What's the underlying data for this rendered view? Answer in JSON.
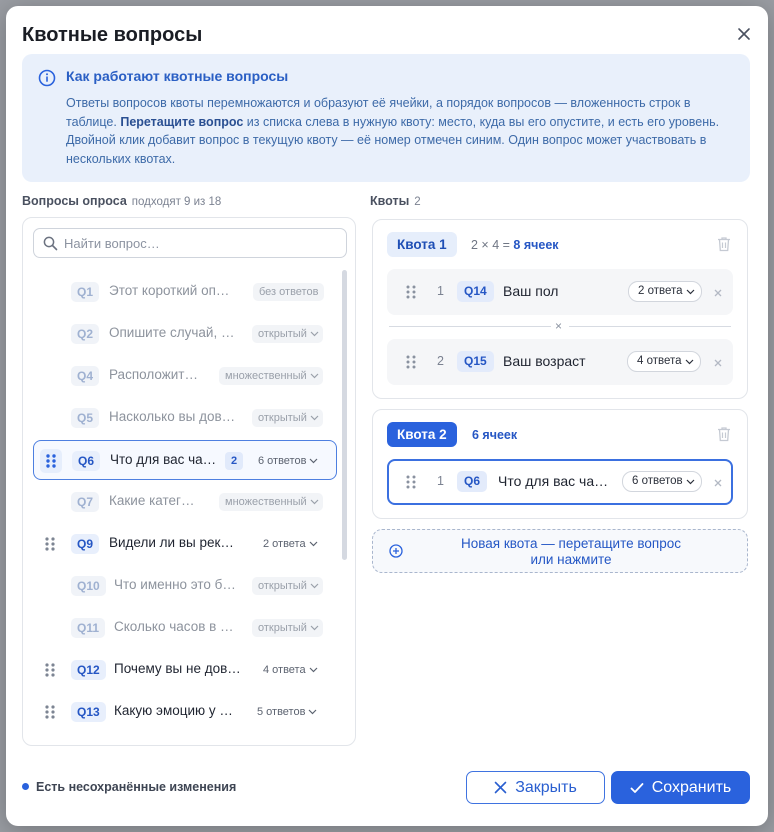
{
  "title": "Квотные вопросы",
  "info": {
    "title": "Как работают квотные вопросы",
    "text_1": "Ответы вопросов квоты перемножаются и образуют её ячейки, а порядок вопросов — вложенность строк в таблице. ",
    "text_bold": "Перетащите вопрос",
    "text_2": " из списка слева в нужную квоту: место, куда вы его опустите, и есть его уровень. Двойной клик добавит вопрос в текущую квоту — её номер отмечен синим. Один вопрос может участвовать в нескольких квотах."
  },
  "left": {
    "label": "Вопросы опроса",
    "sub": "подходят 9 из 18",
    "search_placeholder": "Найти вопрос…",
    "questions": [
      {
        "code": "Q1",
        "text": "Этот короткий оп…",
        "badge": "без ответов",
        "disabled": true
      },
      {
        "code": "Q2",
        "text": "Опишите случай, …",
        "badge": "открытый",
        "disabled": true
      },
      {
        "code": "Q4",
        "text": "Расположит…",
        "badge": "множественный",
        "disabled": true
      },
      {
        "code": "Q5",
        "text": "Насколько вы дов…",
        "badge": "открытый",
        "disabled": true
      },
      {
        "code": "Q6",
        "text": "Что для вас ча…",
        "count": "2",
        "badge": "6 ответов",
        "selected": true
      },
      {
        "code": "Q7",
        "text": "Какие катег…",
        "badge": "множественный",
        "disabled": true
      },
      {
        "code": "Q9",
        "text": "Видели ли вы рек…",
        "badge": "2 ответа"
      },
      {
        "code": "Q10",
        "text": "Что именно это б…",
        "badge": "открытый",
        "disabled": true
      },
      {
        "code": "Q11",
        "text": "Сколько часов в …",
        "badge": "открытый",
        "disabled": true
      },
      {
        "code": "Q12",
        "text": "Почему вы не дов…",
        "badge": "4 ответа"
      },
      {
        "code": "Q13",
        "text": "Какую эмоцию у …",
        "badge": "5 ответов"
      }
    ]
  },
  "right": {
    "label": "Квоты",
    "count": "2",
    "quota1": {
      "tag": "Квота 1",
      "formula": "2 × 4 = ",
      "cells": "8 ячеек",
      "rows": [
        {
          "num": "1",
          "code": "Q14",
          "text": "Ваш пол",
          "select": "2 ответа"
        },
        {
          "num": "2",
          "code": "Q15",
          "text": "Ваш возраст",
          "select": "4 ответа"
        }
      ],
      "times": "×"
    },
    "quota2": {
      "tag": "Квота 2",
      "cells": "6 ячеек",
      "rows": [
        {
          "num": "1",
          "code": "Q6",
          "text": "Что для вас ча…",
          "select": "6 ответов"
        }
      ]
    },
    "new_quota_line1": "Новая квота — перетащите вопрос",
    "new_quota_line2": "или нажмите"
  },
  "footer": {
    "unsaved": "Есть несохранённые изменения",
    "close": "Закрыть",
    "save": "Сохранить"
  },
  "colors": {
    "accent": "#2a62dd",
    "info_bg": "#e9f0fb"
  }
}
